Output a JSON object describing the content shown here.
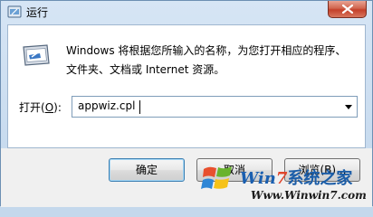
{
  "window": {
    "title": "运行",
    "close_icon": "close-x-icon"
  },
  "dialog": {
    "description": "Windows 将根据您所输入的名称，为您打开相应的程序、文件夹、文档或 Internet 资源。",
    "open_label_prefix": "打开(",
    "open_label_key": "O",
    "open_label_suffix": "):",
    "command_value": "appwiz.cpl"
  },
  "buttons": {
    "ok_label": "确定",
    "cancel_label": "取消",
    "browse_label": "浏览(B)..."
  },
  "watermark": {
    "brand_win": "Win",
    "brand_7": "7",
    "brand_cn": "系统之家",
    "url": "Www.Winwin7.com"
  },
  "colors": {
    "accent": "#3c7fb1",
    "close": "#c4402a"
  }
}
